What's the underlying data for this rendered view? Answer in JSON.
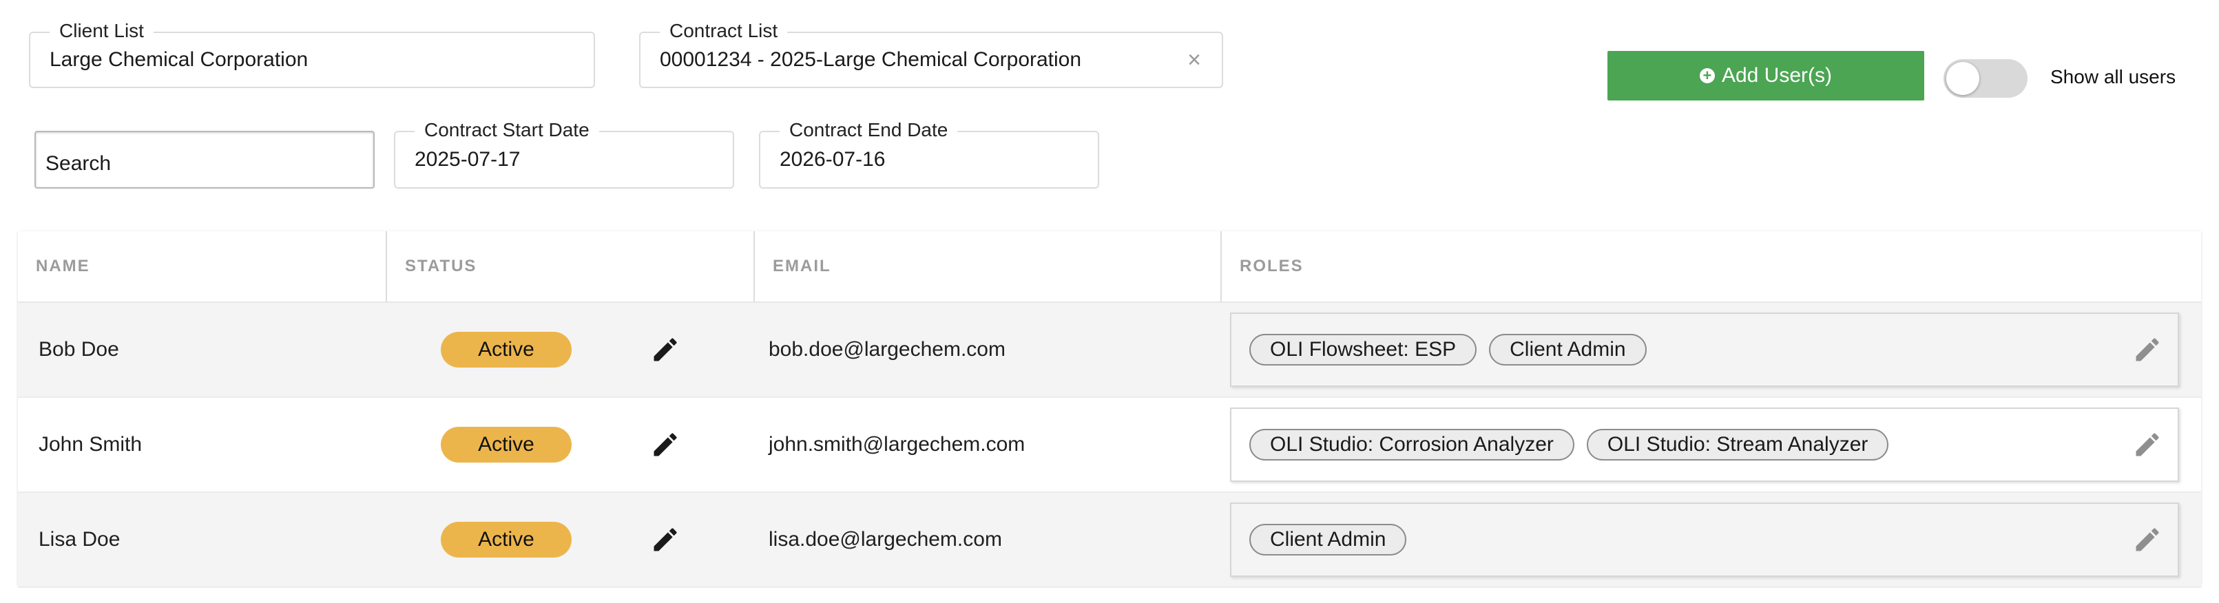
{
  "filters": {
    "client_list": {
      "label": "Client List",
      "value": "Large Chemical Corporation"
    },
    "contract_list": {
      "label": "Contract List",
      "value": "00001234 - 2025-Large Chemical Corporation",
      "clear_symbol": "×"
    },
    "search": {
      "placeholder": "Search"
    },
    "contract_start": {
      "label": "Contract Start Date",
      "value": "2025-07-17"
    },
    "contract_end": {
      "label": "Contract End Date",
      "value": "2026-07-16"
    }
  },
  "actions": {
    "add_users_label": "Add User(s)",
    "add_icon": "plus-circle-icon",
    "show_all_users_label": "Show all users",
    "show_all_users_on": false
  },
  "table": {
    "headers": {
      "name": "NAME",
      "status": "STATUS",
      "email": "EMAIL",
      "roles": "ROLES"
    },
    "rows": [
      {
        "name": "Bob Doe",
        "status": "Active",
        "email": "bob.doe@largechem.com",
        "roles": [
          "OLI Flowsheet: ESP",
          "Client Admin"
        ]
      },
      {
        "name": "John Smith",
        "status": "Active",
        "email": "john.smith@largechem.com",
        "roles": [
          "OLI Studio: Corrosion Analyzer",
          "OLI Studio: Stream Analyzer"
        ]
      },
      {
        "name": "Lisa Doe",
        "status": "Active",
        "email": "lisa.doe@largechem.com",
        "roles": [
          "Client Admin"
        ]
      }
    ]
  },
  "colors": {
    "add_button": "#4ba553",
    "status_active": "#ecb54c",
    "toggle_off": "#d9d9d9",
    "row_alt": "#f4f4f4"
  }
}
